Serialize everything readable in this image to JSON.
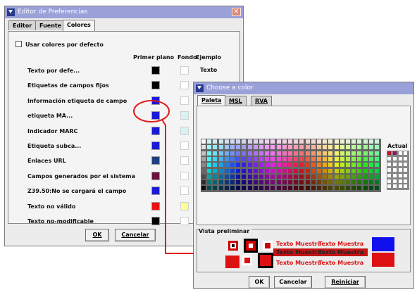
{
  "colors": {
    "titlebar": "#9aa0d8",
    "black": "#000000",
    "blue": "#1a1ad6",
    "navy": "#1f3f80",
    "maroon": "#6b0f3b",
    "red": "#ee1010",
    "yellow": "#ffff99",
    "lightcyan": "#d8f2f2",
    "highlight_ring": "#e21b1b"
  },
  "pref_window": {
    "title": "Editor de Preferencias",
    "tabs": [
      {
        "label": "Editor"
      },
      {
        "label": "Fuente"
      },
      {
        "label": "Colores",
        "active": true
      }
    ],
    "use_default_label": "Usar colores por defecto",
    "columns": {
      "foreground": "Primer plano",
      "background": "Fondo",
      "example": "Ejemplo"
    },
    "rows": [
      {
        "label": "Texto por defe...",
        "fg": "black",
        "bg": "white",
        "example": "Texto"
      },
      {
        "label": "Etiquetas de campos fijos",
        "fg": "black",
        "bg": "white"
      },
      {
        "label": "Información etiqueta de campo",
        "fg": "blue",
        "bg": "white"
      },
      {
        "label": "etiqueta MA...",
        "fg": "blue",
        "bg": "lightcyan"
      },
      {
        "label": "Indicador MARC",
        "fg": "blue",
        "bg": "lightcyan"
      },
      {
        "label": "Etiqueta subca...",
        "fg": "blue",
        "bg": "white"
      },
      {
        "label": "Enlaces URL",
        "fg": "navy",
        "bg": "white"
      },
      {
        "label": "Campos generados por el sistema",
        "fg": "maroon",
        "bg": "white"
      },
      {
        "label": "Z39.50:No se cargará el campo",
        "fg": "blue",
        "bg": "white"
      },
      {
        "label": "Texto no válido",
        "fg": "red",
        "bg": "yellow"
      },
      {
        "label": "Texto no-modificable",
        "fg": "black",
        "bg": "white"
      }
    ],
    "ok_label": "OK",
    "cancel_label": "Cancelar"
  },
  "color_window": {
    "title": "Choose a color",
    "tabs": [
      {
        "label": "Paleta",
        "active": true
      },
      {
        "label": "MSL"
      },
      {
        "label": "RVA"
      }
    ],
    "recent_label": "Actual",
    "preview_label": "Vista preliminar",
    "sample_text": "Texto Muestra",
    "ok_label": "OK",
    "cancel_label": "Cancelar",
    "reset_label": "Reiniciar"
  }
}
